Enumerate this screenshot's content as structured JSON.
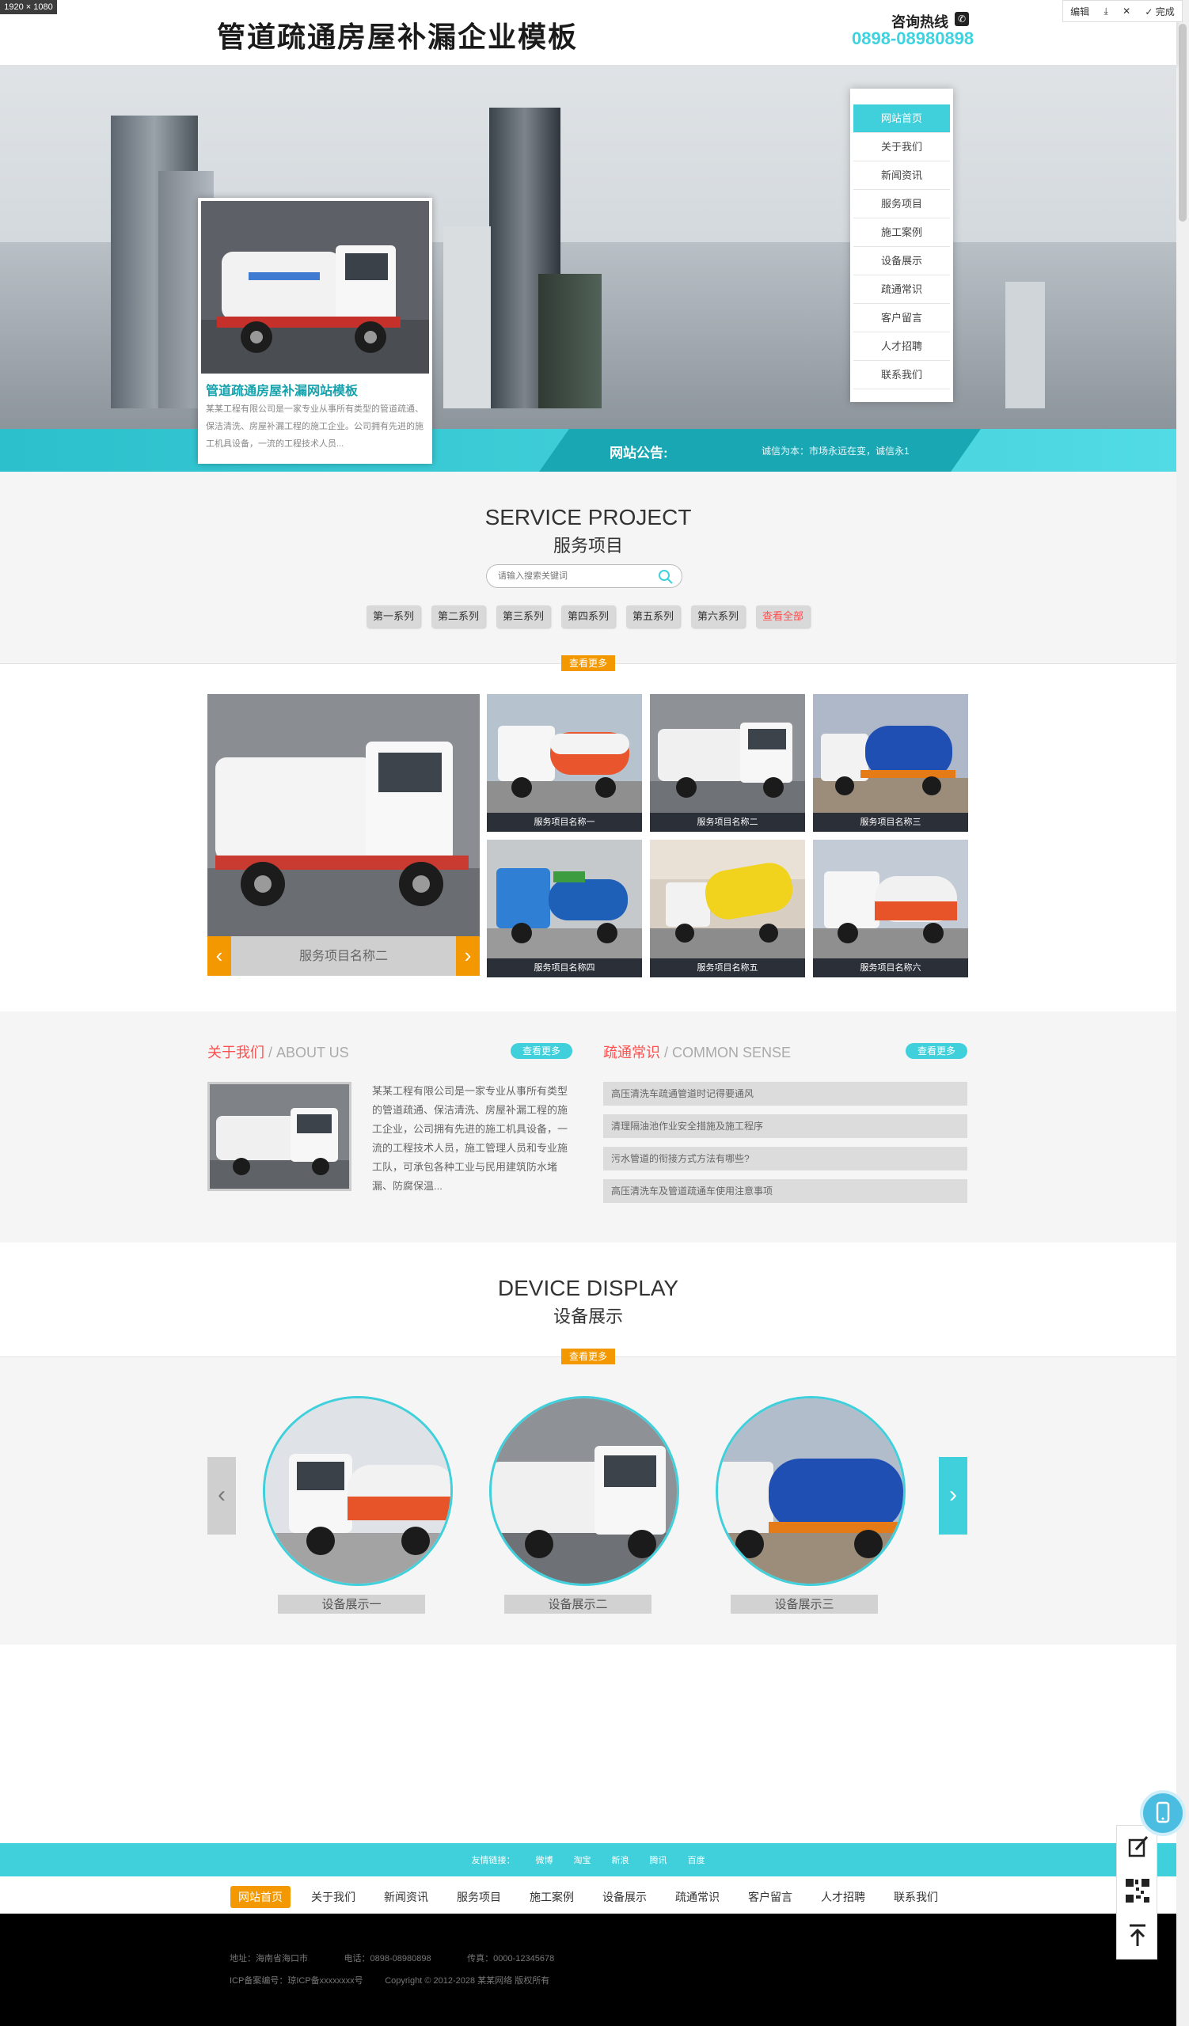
{
  "screenshot": {
    "dimension_label": "1920 × 1080",
    "toolbar": {
      "edit": "编辑",
      "download": "⤓",
      "close": "✕",
      "done": "✓ 完成"
    }
  },
  "header": {
    "site_title": "管道疏通房屋补漏企业模板",
    "hotline_label": "咨询热线",
    "hotline_number": "0898-08980898"
  },
  "banner": {
    "card_title": "管道疏通房屋补漏网站模板",
    "card_desc": "某某工程有限公司是一家专业从事所有类型的管道疏通、保洁清洗、房屋补漏工程的施工企业。公司拥有先进的施工机具设备，一流的工程技术人员...",
    "notice_label": "网站公告:",
    "notice_text": "诚信为本：市场永远在变，诚信永1"
  },
  "nav": {
    "items": [
      "网站首页",
      "关于我们",
      "新闻资讯",
      "服务项目",
      "施工案例",
      "设备展示",
      "疏通常识",
      "客户留言",
      "人才招聘",
      "联系我们"
    ],
    "active_index": 0
  },
  "service": {
    "title_en": "SERVICE PROJECT",
    "title_cn": "服务项目",
    "search_placeholder": "请输入搜索关键词",
    "tabs": [
      "第一系列",
      "第二系列",
      "第三系列",
      "第四系列",
      "第五系列",
      "第六系列",
      "查看全部"
    ],
    "more_label": "查看更多",
    "featured_caption": "服务项目名称二",
    "products": [
      "服务项目名称一",
      "服务项目名称二",
      "服务项目名称三",
      "服务项目名称四",
      "服务项目名称五",
      "服务项目名称六"
    ]
  },
  "about": {
    "title_cn": "关于我们",
    "title_en": " / ABOUT US",
    "more_label": "查看更多",
    "text": "某某工程有限公司是一家专业从事所有类型的管道疏通、保洁清洗、房屋补漏工程的施工企业，公司拥有先进的施工机具设备，一流的工程技术人员，施工管理人员和专业施工队，可承包各种工业与民用建筑防水堵漏、防腐保温..."
  },
  "common_sense": {
    "title_cn": "疏通常识",
    "title_en": " / COMMON SENSE",
    "more_label": "查看更多",
    "items": [
      "高压清洗车疏通管道时记得要通风",
      "清理隔油池作业安全措施及施工程序",
      "污水管道的衔接方式方法有哪些?",
      "高压清洗车及管道疏通车使用注意事项"
    ]
  },
  "device": {
    "title_en": "DEVICE DISPLAY",
    "title_cn": "设备展示",
    "more_label": "查看更多",
    "items": [
      "设备展示一",
      "设备展示二",
      "设备展示三"
    ]
  },
  "footer": {
    "links_label": "友情链接：",
    "links": [
      "微博",
      "淘宝",
      "新浪",
      "腾讯",
      "百度"
    ],
    "nav": [
      "网站首页",
      "关于我们",
      "新闻资讯",
      "服务项目",
      "施工案例",
      "设备展示",
      "疏通常识",
      "客户留言",
      "人才招聘",
      "联系我们"
    ],
    "address": "地址：海南省海口市",
    "phone": "电话：0898-08980898",
    "fax": "传真：0000-12345678",
    "icp": "ICP备案编号：琼ICP备xxxxxxxx号",
    "copyright": "Copyright © 2012-2028 某某网络 版权所有"
  },
  "colors": {
    "accent": "#3fd0dc",
    "orange": "#f39800",
    "red": "#ff4f4f",
    "dark": "#2a2f38"
  },
  "icons": [
    "phone-icon",
    "search-icon",
    "chevron-left-icon",
    "chevron-right-icon",
    "edit-icon",
    "qrcode-icon",
    "back-to-top-icon",
    "mobile-icon"
  ]
}
